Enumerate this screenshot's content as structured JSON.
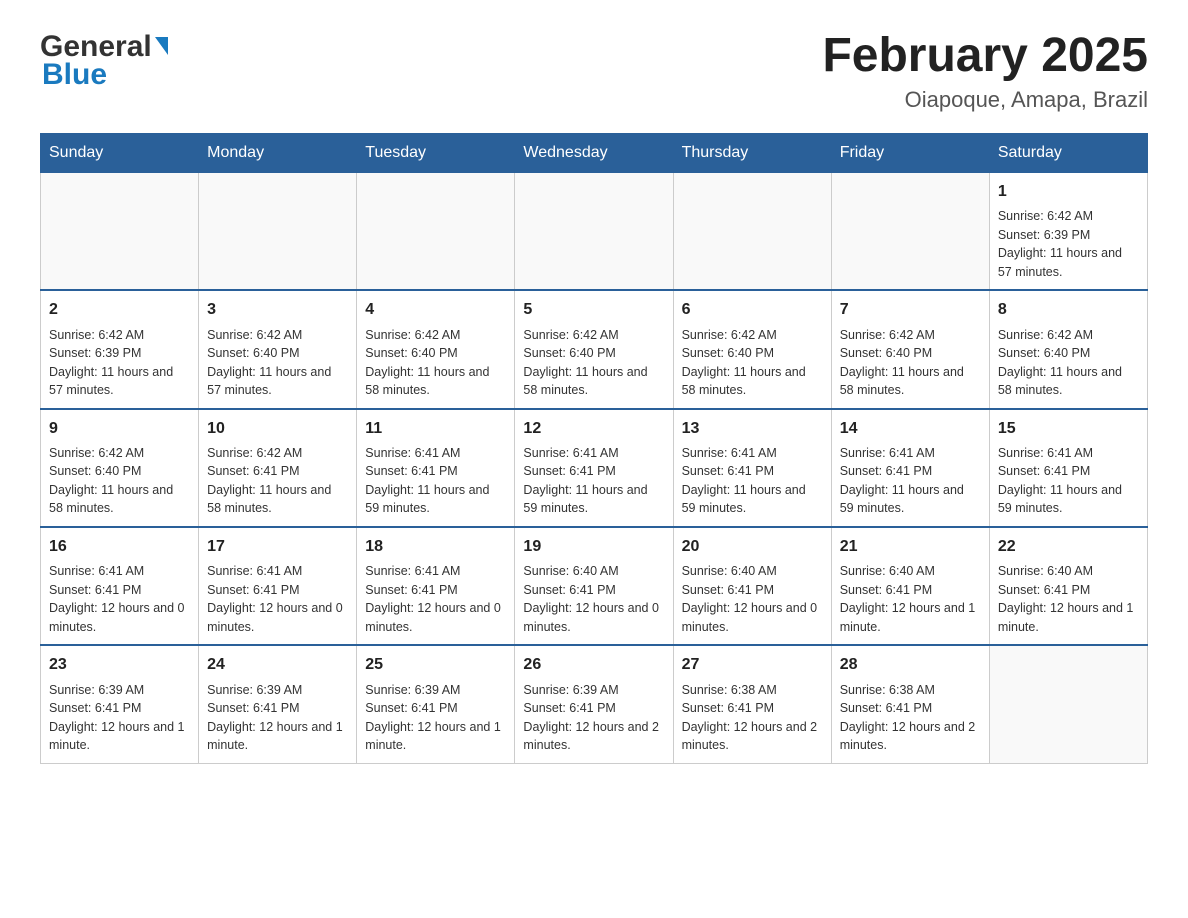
{
  "header": {
    "logo_general": "General",
    "logo_blue": "Blue",
    "title": "February 2025",
    "subtitle": "Oiapoque, Amapa, Brazil"
  },
  "calendar": {
    "days_of_week": [
      "Sunday",
      "Monday",
      "Tuesday",
      "Wednesday",
      "Thursday",
      "Friday",
      "Saturday"
    ],
    "weeks": [
      [
        {
          "day": "",
          "info": ""
        },
        {
          "day": "",
          "info": ""
        },
        {
          "day": "",
          "info": ""
        },
        {
          "day": "",
          "info": ""
        },
        {
          "day": "",
          "info": ""
        },
        {
          "day": "",
          "info": ""
        },
        {
          "day": "1",
          "info": "Sunrise: 6:42 AM\nSunset: 6:39 PM\nDaylight: 11 hours and 57 minutes."
        }
      ],
      [
        {
          "day": "2",
          "info": "Sunrise: 6:42 AM\nSunset: 6:39 PM\nDaylight: 11 hours and 57 minutes."
        },
        {
          "day": "3",
          "info": "Sunrise: 6:42 AM\nSunset: 6:40 PM\nDaylight: 11 hours and 57 minutes."
        },
        {
          "day": "4",
          "info": "Sunrise: 6:42 AM\nSunset: 6:40 PM\nDaylight: 11 hours and 58 minutes."
        },
        {
          "day": "5",
          "info": "Sunrise: 6:42 AM\nSunset: 6:40 PM\nDaylight: 11 hours and 58 minutes."
        },
        {
          "day": "6",
          "info": "Sunrise: 6:42 AM\nSunset: 6:40 PM\nDaylight: 11 hours and 58 minutes."
        },
        {
          "day": "7",
          "info": "Sunrise: 6:42 AM\nSunset: 6:40 PM\nDaylight: 11 hours and 58 minutes."
        },
        {
          "day": "8",
          "info": "Sunrise: 6:42 AM\nSunset: 6:40 PM\nDaylight: 11 hours and 58 minutes."
        }
      ],
      [
        {
          "day": "9",
          "info": "Sunrise: 6:42 AM\nSunset: 6:40 PM\nDaylight: 11 hours and 58 minutes."
        },
        {
          "day": "10",
          "info": "Sunrise: 6:42 AM\nSunset: 6:41 PM\nDaylight: 11 hours and 58 minutes."
        },
        {
          "day": "11",
          "info": "Sunrise: 6:41 AM\nSunset: 6:41 PM\nDaylight: 11 hours and 59 minutes."
        },
        {
          "day": "12",
          "info": "Sunrise: 6:41 AM\nSunset: 6:41 PM\nDaylight: 11 hours and 59 minutes."
        },
        {
          "day": "13",
          "info": "Sunrise: 6:41 AM\nSunset: 6:41 PM\nDaylight: 11 hours and 59 minutes."
        },
        {
          "day": "14",
          "info": "Sunrise: 6:41 AM\nSunset: 6:41 PM\nDaylight: 11 hours and 59 minutes."
        },
        {
          "day": "15",
          "info": "Sunrise: 6:41 AM\nSunset: 6:41 PM\nDaylight: 11 hours and 59 minutes."
        }
      ],
      [
        {
          "day": "16",
          "info": "Sunrise: 6:41 AM\nSunset: 6:41 PM\nDaylight: 12 hours and 0 minutes."
        },
        {
          "day": "17",
          "info": "Sunrise: 6:41 AM\nSunset: 6:41 PM\nDaylight: 12 hours and 0 minutes."
        },
        {
          "day": "18",
          "info": "Sunrise: 6:41 AM\nSunset: 6:41 PM\nDaylight: 12 hours and 0 minutes."
        },
        {
          "day": "19",
          "info": "Sunrise: 6:40 AM\nSunset: 6:41 PM\nDaylight: 12 hours and 0 minutes."
        },
        {
          "day": "20",
          "info": "Sunrise: 6:40 AM\nSunset: 6:41 PM\nDaylight: 12 hours and 0 minutes."
        },
        {
          "day": "21",
          "info": "Sunrise: 6:40 AM\nSunset: 6:41 PM\nDaylight: 12 hours and 1 minute."
        },
        {
          "day": "22",
          "info": "Sunrise: 6:40 AM\nSunset: 6:41 PM\nDaylight: 12 hours and 1 minute."
        }
      ],
      [
        {
          "day": "23",
          "info": "Sunrise: 6:39 AM\nSunset: 6:41 PM\nDaylight: 12 hours and 1 minute."
        },
        {
          "day": "24",
          "info": "Sunrise: 6:39 AM\nSunset: 6:41 PM\nDaylight: 12 hours and 1 minute."
        },
        {
          "day": "25",
          "info": "Sunrise: 6:39 AM\nSunset: 6:41 PM\nDaylight: 12 hours and 1 minute."
        },
        {
          "day": "26",
          "info": "Sunrise: 6:39 AM\nSunset: 6:41 PM\nDaylight: 12 hours and 2 minutes."
        },
        {
          "day": "27",
          "info": "Sunrise: 6:38 AM\nSunset: 6:41 PM\nDaylight: 12 hours and 2 minutes."
        },
        {
          "day": "28",
          "info": "Sunrise: 6:38 AM\nSunset: 6:41 PM\nDaylight: 12 hours and 2 minutes."
        },
        {
          "day": "",
          "info": ""
        }
      ]
    ]
  }
}
